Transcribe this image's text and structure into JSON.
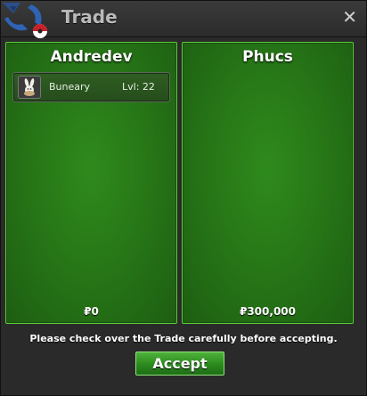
{
  "window": {
    "title": "Trade",
    "close_symbol": "✕"
  },
  "traders": [
    {
      "name": "Andredev",
      "money": "₽0",
      "pokemon": [
        {
          "name": "Buneary",
          "level_text": "Lvl: 22",
          "icon": "buneary-icon"
        }
      ]
    },
    {
      "name": "Phucs",
      "money": "₽300,000",
      "pokemon": []
    }
  ],
  "footer": {
    "notice": "Please check over the Trade carefully before accepting.",
    "accept_label": "Accept"
  },
  "colors": {
    "panel_green": "#257316",
    "panel_border": "#5ccc39",
    "accept_green": "#2a8a1e",
    "window_bg": "#2a2a2a"
  }
}
